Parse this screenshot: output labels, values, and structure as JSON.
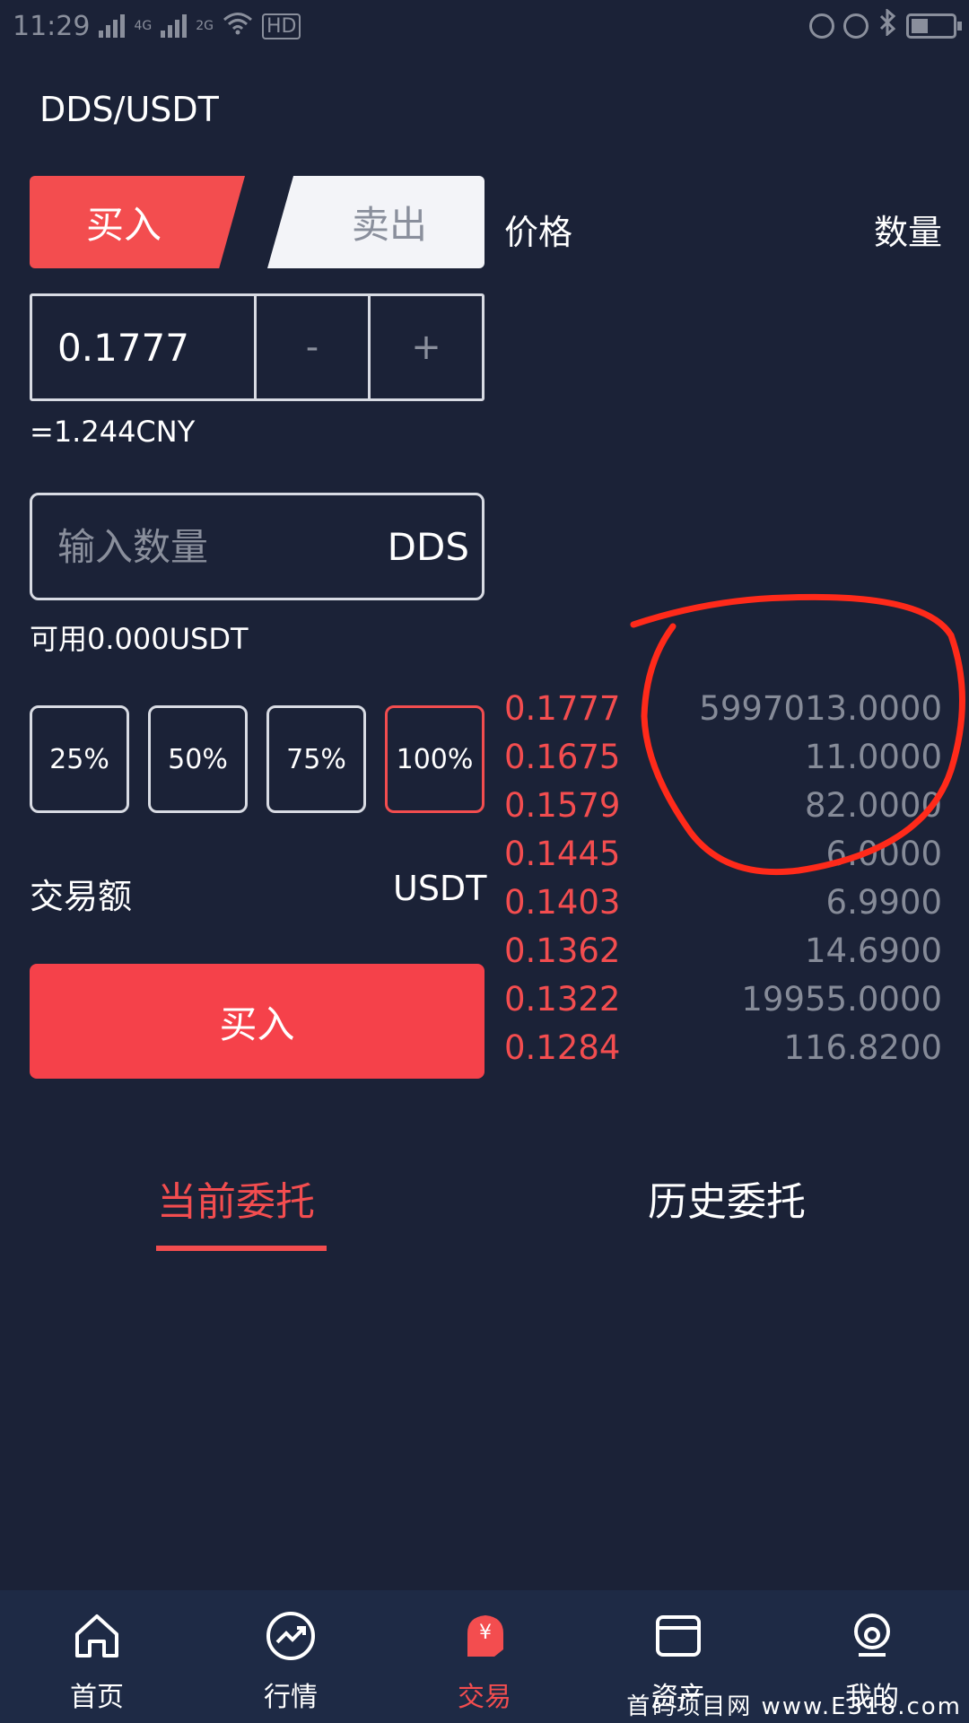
{
  "status_bar": {
    "time": "11:29",
    "net1": "4G",
    "net2": "2G",
    "hd": "HD"
  },
  "pair": "DDS/USDT",
  "tabs": {
    "buy": "买入",
    "sell": "卖出"
  },
  "orderbook_header": {
    "price": "价格",
    "quantity": "数量"
  },
  "price_input": {
    "value": "0.1777",
    "minus": "-",
    "plus": "+"
  },
  "cny_estimate": "=1.244CNY",
  "quantity_input": {
    "placeholder": "输入数量",
    "unit": "DDS"
  },
  "available": "可用0.000USDT",
  "percent_buttons": [
    "25%",
    "50%",
    "75%",
    "100%"
  ],
  "trade_amount": {
    "label": "交易额",
    "unit": "USDT"
  },
  "submit_label": "买入",
  "orderbook": [
    {
      "price": "0.1777",
      "quantity": "5997013.0000"
    },
    {
      "price": "0.1675",
      "quantity": "11.0000"
    },
    {
      "price": "0.1579",
      "quantity": "82.0000"
    },
    {
      "price": "0.1445",
      "quantity": "6.0000"
    },
    {
      "price": "0.1403",
      "quantity": "6.9900"
    },
    {
      "price": "0.1362",
      "quantity": "14.6900"
    },
    {
      "price": "0.1322",
      "quantity": "19955.0000"
    },
    {
      "price": "0.1284",
      "quantity": "116.8200"
    }
  ],
  "order_tabs": {
    "current": "当前委托",
    "history": "历史委托"
  },
  "bottom_nav": [
    {
      "label": "首页",
      "icon": "home-icon"
    },
    {
      "label": "行情",
      "icon": "market-trend-icon"
    },
    {
      "label": "交易",
      "icon": "trade-yen-icon"
    },
    {
      "label": "资产",
      "icon": "wallet-icon"
    },
    {
      "label": "我的",
      "icon": "profile-icon"
    }
  ],
  "colors": {
    "background": "#1b2237",
    "accent": "#f34d4f",
    "nav_bg": "#1e2a45",
    "muted": "#868b98"
  },
  "annotation_color": "#ff2a1a",
  "watermark": "首码项目网 www.E318.com"
}
